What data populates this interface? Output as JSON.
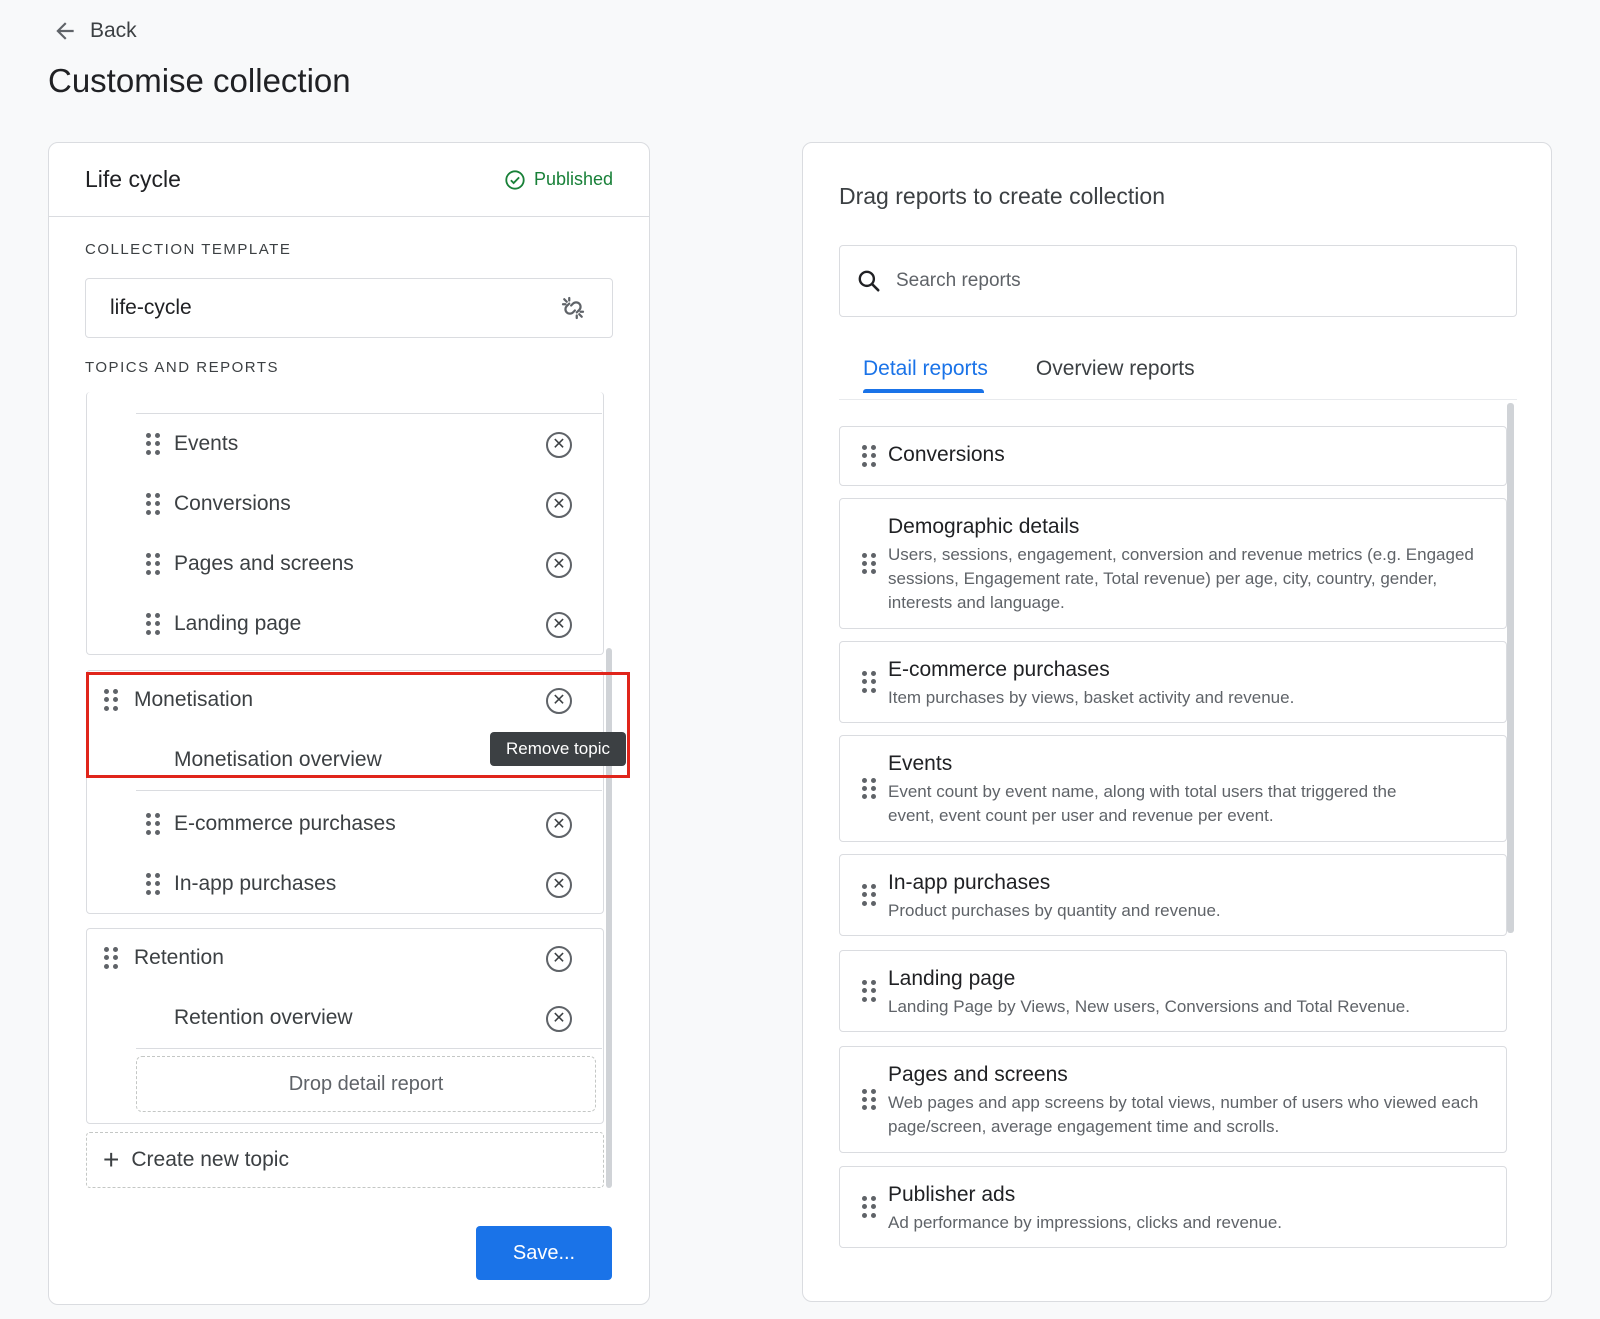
{
  "header": {
    "back_label": "Back",
    "page_title": "Customise collection"
  },
  "left_panel": {
    "collection_name": "Life cycle",
    "status": "Published",
    "collection_template_label": "COLLECTION TEMPLATE",
    "template_value": "life-cycle",
    "topics_label": "TOPICS AND REPORTS",
    "topics": [
      {
        "name": "",
        "reports": [
          "Events",
          "Conversions",
          "Pages and screens",
          "Landing page"
        ]
      },
      {
        "name": "Monetisation",
        "reports": [
          "Monetisation overview",
          "E-commerce purchases",
          "In-app purchases"
        ]
      },
      {
        "name": "Retention",
        "reports": [
          "Retention overview"
        ],
        "drop_zone": "Drop detail report"
      }
    ],
    "tooltip": "Remove topic",
    "create_topic": "Create new topic",
    "save_label": "Save..."
  },
  "right_panel": {
    "title": "Drag reports to create collection",
    "search_placeholder": "Search reports",
    "tabs": [
      "Detail reports",
      "Overview reports"
    ],
    "active_tab": "Detail reports",
    "reports": [
      {
        "title": "Conversions",
        "description": ""
      },
      {
        "title": "Demographic details",
        "description": "Users, sessions, engagement, conversion and revenue metrics (e.g. Engaged sessions, Engagement rate, Total revenue) per age, city, country, gender, interests and language."
      },
      {
        "title": "E-commerce purchases",
        "description": "Item purchases by views, basket activity and revenue."
      },
      {
        "title": "Events",
        "description": "Event count by event name, along with total users that triggered the event, event count per user and revenue per event."
      },
      {
        "title": "In-app purchases",
        "description": "Product purchases by quantity and revenue."
      },
      {
        "title": "Landing page",
        "description": "Landing Page by Views, New users, Conversions and Total Revenue."
      },
      {
        "title": "Pages and screens",
        "description": "Web pages and app screens by total views, number of users who viewed each page/screen, average engagement time and scrolls."
      },
      {
        "title": "Publisher ads",
        "description": "Ad performance by impressions, clicks and revenue."
      }
    ]
  },
  "colors": {
    "accent": "#1a73e8",
    "published": "#188038",
    "highlight_box": "#e0251b"
  }
}
